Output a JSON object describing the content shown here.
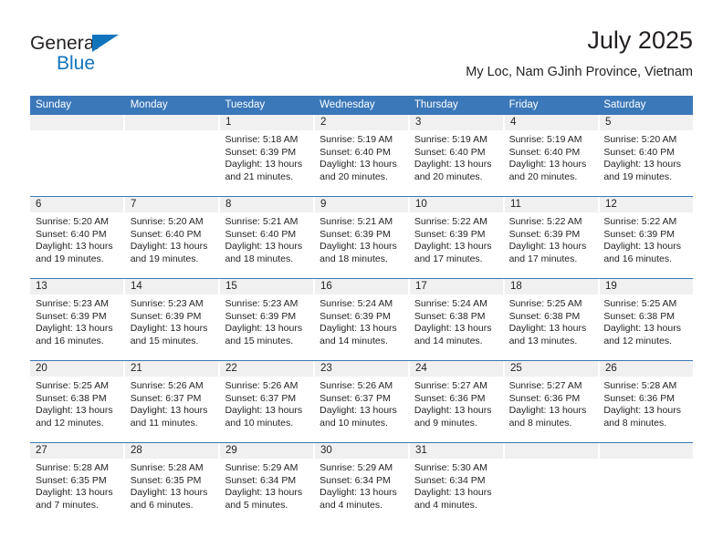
{
  "logo": {
    "word_primary": "General",
    "word_secondary": "Blue",
    "triangle_color": "#1273bd"
  },
  "header": {
    "title": "July 2025",
    "subtitle": "My Loc, Nam GJinh Province, Vietnam"
  },
  "theme": {
    "header_blue": "#3b78b9",
    "daynum_band": "#f0f0f0",
    "text": "#231f20"
  },
  "weekdays": [
    "Sunday",
    "Monday",
    "Tuesday",
    "Wednesday",
    "Thursday",
    "Friday",
    "Saturday"
  ],
  "weeks": [
    {
      "days": [
        {
          "num": "",
          "lines": []
        },
        {
          "num": "",
          "lines": []
        },
        {
          "num": "1",
          "lines": [
            "Sunrise: 5:18 AM",
            "Sunset: 6:39 PM",
            "Daylight: 13 hours",
            "and 21 minutes."
          ]
        },
        {
          "num": "2",
          "lines": [
            "Sunrise: 5:19 AM",
            "Sunset: 6:40 PM",
            "Daylight: 13 hours",
            "and 20 minutes."
          ]
        },
        {
          "num": "3",
          "lines": [
            "Sunrise: 5:19 AM",
            "Sunset: 6:40 PM",
            "Daylight: 13 hours",
            "and 20 minutes."
          ]
        },
        {
          "num": "4",
          "lines": [
            "Sunrise: 5:19 AM",
            "Sunset: 6:40 PM",
            "Daylight: 13 hours",
            "and 20 minutes."
          ]
        },
        {
          "num": "5",
          "lines": [
            "Sunrise: 5:20 AM",
            "Sunset: 6:40 PM",
            "Daylight: 13 hours",
            "and 19 minutes."
          ]
        }
      ]
    },
    {
      "days": [
        {
          "num": "6",
          "lines": [
            "Sunrise: 5:20 AM",
            "Sunset: 6:40 PM",
            "Daylight: 13 hours",
            "and 19 minutes."
          ]
        },
        {
          "num": "7",
          "lines": [
            "Sunrise: 5:20 AM",
            "Sunset: 6:40 PM",
            "Daylight: 13 hours",
            "and 19 minutes."
          ]
        },
        {
          "num": "8",
          "lines": [
            "Sunrise: 5:21 AM",
            "Sunset: 6:40 PM",
            "Daylight: 13 hours",
            "and 18 minutes."
          ]
        },
        {
          "num": "9",
          "lines": [
            "Sunrise: 5:21 AM",
            "Sunset: 6:39 PM",
            "Daylight: 13 hours",
            "and 18 minutes."
          ]
        },
        {
          "num": "10",
          "lines": [
            "Sunrise: 5:22 AM",
            "Sunset: 6:39 PM",
            "Daylight: 13 hours",
            "and 17 minutes."
          ]
        },
        {
          "num": "11",
          "lines": [
            "Sunrise: 5:22 AM",
            "Sunset: 6:39 PM",
            "Daylight: 13 hours",
            "and 17 minutes."
          ]
        },
        {
          "num": "12",
          "lines": [
            "Sunrise: 5:22 AM",
            "Sunset: 6:39 PM",
            "Daylight: 13 hours",
            "and 16 minutes."
          ]
        }
      ]
    },
    {
      "days": [
        {
          "num": "13",
          "lines": [
            "Sunrise: 5:23 AM",
            "Sunset: 6:39 PM",
            "Daylight: 13 hours",
            "and 16 minutes."
          ]
        },
        {
          "num": "14",
          "lines": [
            "Sunrise: 5:23 AM",
            "Sunset: 6:39 PM",
            "Daylight: 13 hours",
            "and 15 minutes."
          ]
        },
        {
          "num": "15",
          "lines": [
            "Sunrise: 5:23 AM",
            "Sunset: 6:39 PM",
            "Daylight: 13 hours",
            "and 15 minutes."
          ]
        },
        {
          "num": "16",
          "lines": [
            "Sunrise: 5:24 AM",
            "Sunset: 6:39 PM",
            "Daylight: 13 hours",
            "and 14 minutes."
          ]
        },
        {
          "num": "17",
          "lines": [
            "Sunrise: 5:24 AM",
            "Sunset: 6:38 PM",
            "Daylight: 13 hours",
            "and 14 minutes."
          ]
        },
        {
          "num": "18",
          "lines": [
            "Sunrise: 5:25 AM",
            "Sunset: 6:38 PM",
            "Daylight: 13 hours",
            "and 13 minutes."
          ]
        },
        {
          "num": "19",
          "lines": [
            "Sunrise: 5:25 AM",
            "Sunset: 6:38 PM",
            "Daylight: 13 hours",
            "and 12 minutes."
          ]
        }
      ]
    },
    {
      "days": [
        {
          "num": "20",
          "lines": [
            "Sunrise: 5:25 AM",
            "Sunset: 6:38 PM",
            "Daylight: 13 hours",
            "and 12 minutes."
          ]
        },
        {
          "num": "21",
          "lines": [
            "Sunrise: 5:26 AM",
            "Sunset: 6:37 PM",
            "Daylight: 13 hours",
            "and 11 minutes."
          ]
        },
        {
          "num": "22",
          "lines": [
            "Sunrise: 5:26 AM",
            "Sunset: 6:37 PM",
            "Daylight: 13 hours",
            "and 10 minutes."
          ]
        },
        {
          "num": "23",
          "lines": [
            "Sunrise: 5:26 AM",
            "Sunset: 6:37 PM",
            "Daylight: 13 hours",
            "and 10 minutes."
          ]
        },
        {
          "num": "24",
          "lines": [
            "Sunrise: 5:27 AM",
            "Sunset: 6:36 PM",
            "Daylight: 13 hours",
            "and 9 minutes."
          ]
        },
        {
          "num": "25",
          "lines": [
            "Sunrise: 5:27 AM",
            "Sunset: 6:36 PM",
            "Daylight: 13 hours",
            "and 8 minutes."
          ]
        },
        {
          "num": "26",
          "lines": [
            "Sunrise: 5:28 AM",
            "Sunset: 6:36 PM",
            "Daylight: 13 hours",
            "and 8 minutes."
          ]
        }
      ]
    },
    {
      "days": [
        {
          "num": "27",
          "lines": [
            "Sunrise: 5:28 AM",
            "Sunset: 6:35 PM",
            "Daylight: 13 hours",
            "and 7 minutes."
          ]
        },
        {
          "num": "28",
          "lines": [
            "Sunrise: 5:28 AM",
            "Sunset: 6:35 PM",
            "Daylight: 13 hours",
            "and 6 minutes."
          ]
        },
        {
          "num": "29",
          "lines": [
            "Sunrise: 5:29 AM",
            "Sunset: 6:34 PM",
            "Daylight: 13 hours",
            "and 5 minutes."
          ]
        },
        {
          "num": "30",
          "lines": [
            "Sunrise: 5:29 AM",
            "Sunset: 6:34 PM",
            "Daylight: 13 hours",
            "and 4 minutes."
          ]
        },
        {
          "num": "31",
          "lines": [
            "Sunrise: 5:30 AM",
            "Sunset: 6:34 PM",
            "Daylight: 13 hours",
            "and 4 minutes."
          ]
        },
        {
          "num": "",
          "lines": []
        },
        {
          "num": "",
          "lines": []
        }
      ]
    }
  ]
}
